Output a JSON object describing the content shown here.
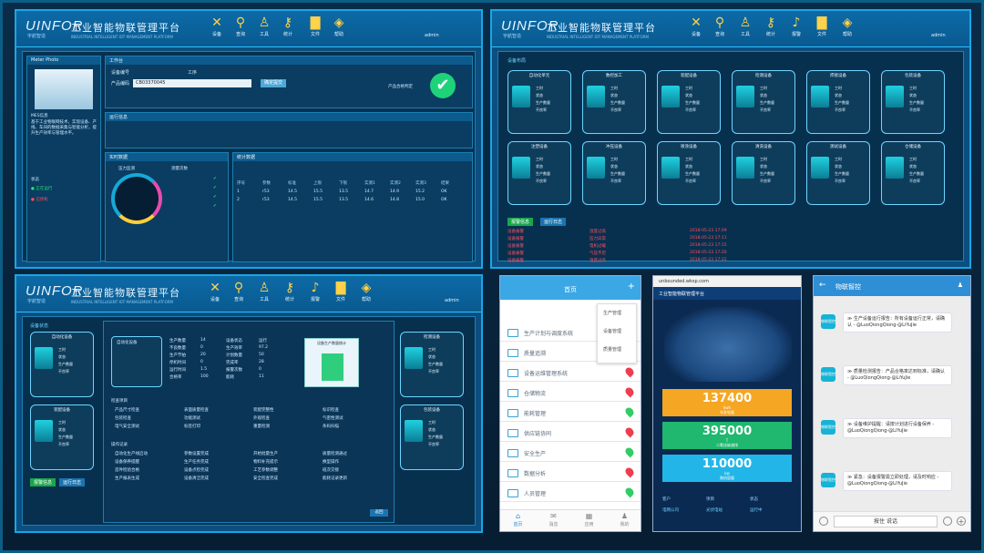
{
  "brand": {
    "logo": "UINFOR",
    "logo_sub": "宇航智造",
    "title": "工业智能物联管理平台",
    "subtitle": "INDUSTRIAL INTELLIGENT IOT MANAGEMENT PLATFORM"
  },
  "toolbar": [
    "设备",
    "查询",
    "工具",
    "统计",
    "报警",
    "文件",
    "帮助"
  ],
  "user": "admin",
  "p1": {
    "sections": {
      "device_photo": "Meter Photo",
      "work_order": "工作台",
      "info": "运行信息",
      "realtime": "实时数据",
      "spc": "统计数据",
      "mes_info": "MES信息",
      "status": "状态"
    },
    "fields": {
      "device_no": "设备编号",
      "process": "工序",
      "product": "产品编码",
      "product_value": "CB03370045",
      "confirm_btn": "确定提交",
      "status_ok": "产品合格判定"
    },
    "desc": "基于工业物联网技术，实现设备、产线、车间的数据采集与智能分析，提升生产效率与管理水平。",
    "status_items": [
      "正在运行",
      "已停机"
    ],
    "spc_count": "测量次数",
    "table_header": [
      "序号",
      "参数",
      "标准",
      "上限",
      "下限",
      "实测1",
      "实测2",
      "实测3",
      "结果"
    ],
    "table_rows": [
      [
        "1",
        "r53",
        "14.5",
        "15.5",
        "13.5",
        "14.7",
        "14.9",
        "15.2",
        "OK"
      ],
      [
        "2",
        "r53",
        "14.5",
        "15.5",
        "13.5",
        "14.6",
        "14.8",
        "15.0",
        "OK"
      ]
    ],
    "gauge": "压力监测"
  },
  "p2": {
    "section": "设备布局",
    "machines": [
      "自动化单元",
      "数控加工",
      "装配设备",
      "检测设备",
      "焊接设备",
      "包装设备",
      "注塑设备",
      "冲压设备",
      "喷涂设备",
      "清洗设备",
      "测试设备",
      "仓储设备"
    ],
    "machine_stats": [
      "工时",
      "状态",
      "生产数量",
      "不良率"
    ],
    "tabs": [
      "报警信息",
      "运行日志"
    ],
    "alarms": [
      [
        "设备报警",
        "温度过高",
        "2018-05-23 17:09"
      ],
      [
        "设备报警",
        "压力异常",
        "2018-05-23 17:11"
      ],
      [
        "设备报警",
        "电机过载",
        "2018-05-23 17:15"
      ],
      [
        "设备报警",
        "气压不足",
        "2018-05-23 17:20"
      ],
      [
        "设备报警",
        "温度过高",
        "2018-05-23 17:22"
      ]
    ]
  },
  "p3": {
    "section": "设备状态",
    "left_machines": [
      "自动化设备",
      "装配设备"
    ],
    "right_machines": [
      "检测设备",
      "包装设备"
    ],
    "detail_title": "自动化设备",
    "detail_stats": [
      [
        "生产数量",
        "14"
      ],
      [
        "不良数量",
        "0"
      ],
      [
        "生产节拍",
        "20"
      ],
      [
        "停机时间",
        "0"
      ],
      [
        "运行时间",
        "1.5"
      ],
      [
        "合格率",
        "100"
      ]
    ],
    "detail_stats2": [
      [
        "设备状态",
        "运行"
      ],
      [
        "生产效率",
        "97.2"
      ],
      [
        "计划数量",
        "50"
      ],
      [
        "完成率",
        "28"
      ],
      [
        "报警次数",
        "0"
      ],
      [
        "能耗",
        "11"
      ]
    ],
    "chart_title": "设备生产数量统计",
    "checklist_title": "检查项目",
    "checklist": [
      "产品尺寸检查",
      "表面质量检查",
      "装配完整性",
      "标识检查",
      "包装检查",
      "功能测试",
      "外观检查",
      "气密性测试",
      "电气安全测试",
      "标签打印",
      "重量检测",
      "条码扫描"
    ],
    "ops_title": "操作记录",
    "ops": [
      "自动化生产线启动",
      "参数设置完成",
      "开始批量生产",
      "质量检测通过",
      "设备保养提醒",
      "生产任务完成",
      "物料补充提示",
      "换型操作",
      "首件检验合格",
      "设备点检完成",
      "工艺参数调整",
      "班次交接",
      "生产报表生成",
      "设备清洁完成",
      "安全检查完成",
      "能耗记录更新"
    ],
    "tabs": [
      "报警信息",
      "运行日志"
    ],
    "btn": "返回"
  },
  "phone1": {
    "title": "首页",
    "menu": [
      "生产管理",
      "设备管理",
      "质量管理"
    ],
    "items": [
      "生产计划与调度系统",
      "质量追溯",
      "设备运维管理系统",
      "仓储物流",
      "能耗管理",
      "供应链协同",
      "安全生产",
      "数据分析",
      "人员管理"
    ],
    "tabs": [
      "首页",
      "消息",
      "应用",
      "我的"
    ],
    "tab_icons": [
      "home-icon",
      "message-icon",
      "app-icon",
      "profile-icon"
    ]
  },
  "phone2": {
    "url": "unbounded.wksp.com",
    "title": "工业智能物联管理平台",
    "stats": [
      [
        "137400",
        "kwh",
        "年发电量"
      ],
      [
        "395000",
        "T",
        "二氧化碳减排"
      ],
      [
        "110000",
        "kw",
        "装机容量"
      ]
    ],
    "table_header": [
      "客户",
      "项目",
      "状态"
    ],
    "table_row": [
      "电网公司",
      "光伏电站",
      "运行中"
    ]
  },
  "phone3": {
    "title": "物联智控",
    "messages": [
      {
        "avatar": "物联智控",
        "text": "≫ 生产设备运行报告：所有设备运行正常，请确认 - @LuoQiongQiong-@LiYuJie"
      },
      {
        "avatar": "物联智控",
        "text": "≫ 质量检测报告：产品合格率达到标准，请确认 - @LuoQiongQiong-@LiYuJie"
      },
      {
        "avatar": "物联智控",
        "text": "≫ 设备维护提醒：请按计划进行设备保养 - @LuoQiongQiong-@LiYuJie"
      },
      {
        "avatar": "物联智控",
        "text": "≫ 紧急：设备报警需立即处理，请及时响应 - @LuoQiongQiong-@LiYuJie"
      }
    ],
    "input": "按住 说话"
  }
}
